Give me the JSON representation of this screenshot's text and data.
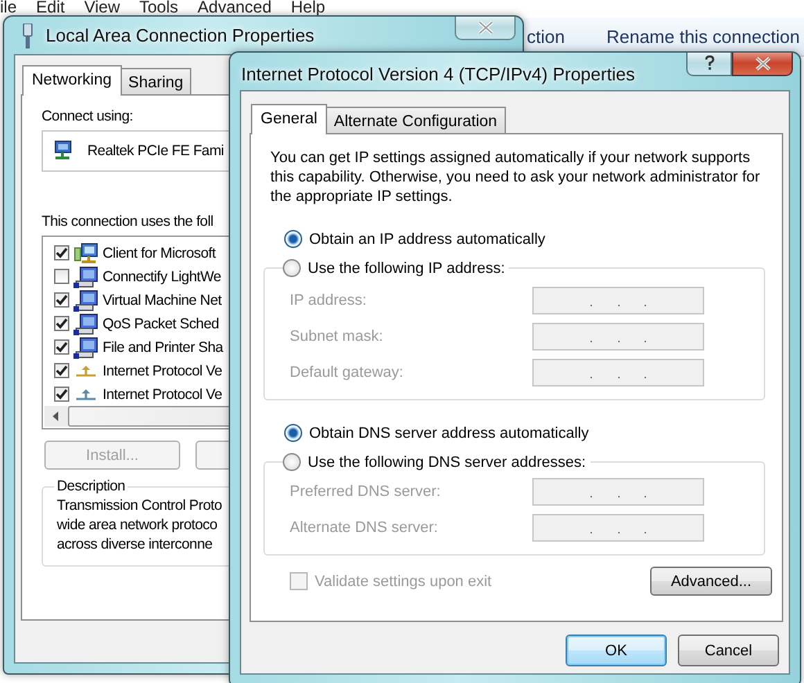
{
  "background_window": {
    "menu": [
      "ile",
      "Edit",
      "View",
      "Tools",
      "Advanced",
      "Help"
    ],
    "toolbar": [
      "ction",
      "Rename this connection"
    ]
  },
  "connection_dialog": {
    "title": "Local Area Connection Properties",
    "tabs": [
      {
        "label": "Networking",
        "selected": true
      },
      {
        "label": "Sharing",
        "selected": false
      }
    ],
    "connect_using_label": "Connect using:",
    "adapter": "Realtek PCIe FE Fami",
    "components_label": "This connection uses the foll",
    "components": [
      {
        "label": "Client for Microsoft",
        "checked": true,
        "kind": "client"
      },
      {
        "label": "Connectify LightWe",
        "checked": false,
        "kind": "service"
      },
      {
        "label": "Virtual Machine Net",
        "checked": true,
        "kind": "service"
      },
      {
        "label": "QoS Packet Sched",
        "checked": true,
        "kind": "service"
      },
      {
        "label": "File and Printer Sha",
        "checked": true,
        "kind": "service"
      },
      {
        "label": "Internet Protocol Ve",
        "checked": true,
        "kind": "protocol",
        "color": "#c8a030"
      },
      {
        "label": "Internet Protocol Ve",
        "checked": true,
        "kind": "protocol",
        "color": "#5a8aa8"
      }
    ],
    "install_button": {
      "label": "Install...",
      "disabled": true
    },
    "description": {
      "title": "Description",
      "lines": [
        "Transmission Control Proto",
        "wide area network protoco",
        "across diverse interconne"
      ]
    }
  },
  "ipv4_dialog": {
    "title": "Internet Protocol Version 4 (TCP/IPv4) Properties",
    "tabs": [
      {
        "label": "General",
        "selected": true
      },
      {
        "label": "Alternate Configuration",
        "selected": false
      }
    ],
    "intro": "You can get IP settings assigned automatically if your network supports this capability. Otherwise, you need to ask your network administrator for the appropriate IP settings.",
    "ip_options": [
      {
        "label": "Obtain an IP address automatically",
        "selected": true
      },
      {
        "label": "Use the following IP address:",
        "selected": false
      }
    ],
    "ip_fields": [
      {
        "label": "IP address:",
        "disabled": true
      },
      {
        "label": "Subnet mask:",
        "disabled": true
      },
      {
        "label": "Default gateway:",
        "disabled": true
      }
    ],
    "dns_options": [
      {
        "label": "Obtain DNS server address automatically",
        "selected": true
      },
      {
        "label": "Use the following DNS server addresses:",
        "selected": false
      }
    ],
    "dns_fields": [
      {
        "label": "Preferred DNS server:",
        "disabled": true
      },
      {
        "label": "Alternate DNS server:",
        "disabled": true
      }
    ],
    "validate_checkbox": {
      "label": "Validate settings upon exit",
      "checked": false,
      "disabled": true
    },
    "advanced_button": "Advanced...",
    "buttons": [
      {
        "label": "OK",
        "default": true
      },
      {
        "label": "Cancel",
        "default": false
      }
    ]
  }
}
